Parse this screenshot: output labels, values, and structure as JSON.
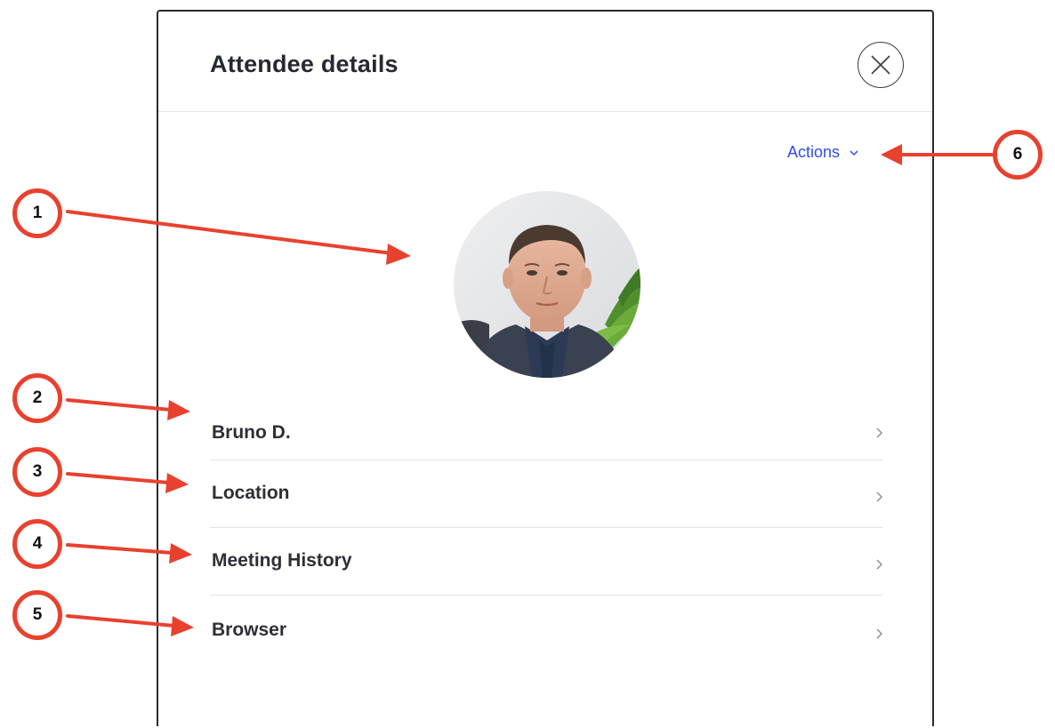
{
  "dialog": {
    "title": "Attendee details",
    "close_icon": "close-icon",
    "actions_label": "Actions",
    "actions_icon": "chevron-down-icon",
    "avatar": {
      "description_icon": "attendee-photo",
      "background": "#e9eaec"
    }
  },
  "rows": [
    {
      "label": "Bruno D.",
      "icon": "chevron-right-icon"
    },
    {
      "label": "Location",
      "icon": "chevron-right-icon"
    },
    {
      "label": "Meeting History",
      "icon": "chevron-right-icon"
    },
    {
      "label": "Browser",
      "icon": "chevron-right-icon"
    }
  ],
  "annotations": {
    "items": [
      "1",
      "2",
      "3",
      "4",
      "5",
      "6"
    ],
    "color": "#e8412e"
  },
  "colors": {
    "accent": "#2f4bf2",
    "title_text": "#262a33",
    "divider": "#e2e2e2"
  }
}
